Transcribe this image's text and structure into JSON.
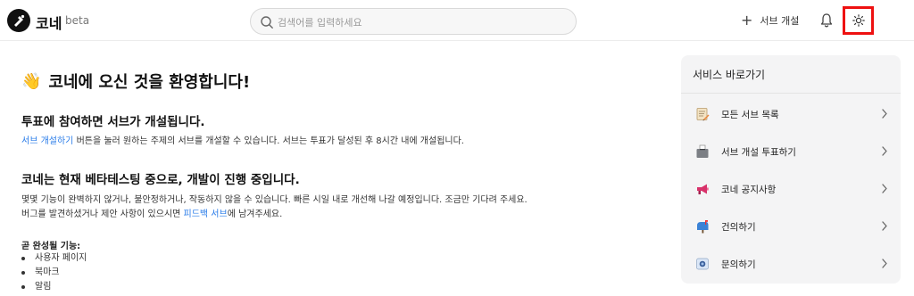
{
  "header": {
    "brand": "코네",
    "beta": "beta",
    "search_placeholder": "검색어를 입력하세요",
    "create_sub_label": "서브 개설"
  },
  "main": {
    "welcome": "코네에 오신 것을 환영합니다!",
    "section1": {
      "title": "투표에 참여하면 서브가 개설됩니다.",
      "link": "서브 개설하기",
      "text": " 버튼을 눌러 원하는 주제의 서브를 개설할 수 있습니다. 서브는 투표가 달성된 후 8시간 내에 개설됩니다."
    },
    "section2": {
      "title": "코네는 현재 베타테스팅 중으로, 개발이 진행 중입니다.",
      "line1": "몇몇 기능이 완벽하지 않거나, 불안정하거나, 작동하지 않을 수 있습니다. 빠른 시일 내로 개선해 나갈 예정입니다. 조금만 기다려 주세요.",
      "line2_pre": "버그를 발견하셨거나 제안 사항이 있으시면 ",
      "line2_link": "피드백 서브",
      "line2_post": "에 남겨주세요."
    },
    "soon": {
      "title": "곧 완성될 기능:",
      "items": [
        "사용자 페이지",
        "북마크",
        "알림"
      ]
    }
  },
  "sidebar": {
    "title": "서비스 바로가기",
    "items": [
      {
        "label": "모든 서브 목록",
        "icon": "memo-icon"
      },
      {
        "label": "서브 개설 투표하기",
        "icon": "ballot-box-icon"
      },
      {
        "label": "코네 공지사항",
        "icon": "megaphone-icon"
      },
      {
        "label": "건의하기",
        "icon": "mailbox-icon"
      },
      {
        "label": "문의하기",
        "icon": "support-icon"
      }
    ]
  },
  "colors": {
    "accent_link": "#2b7de9",
    "highlight_box": "#ee1111",
    "card_bg": "#f4f4f5"
  }
}
